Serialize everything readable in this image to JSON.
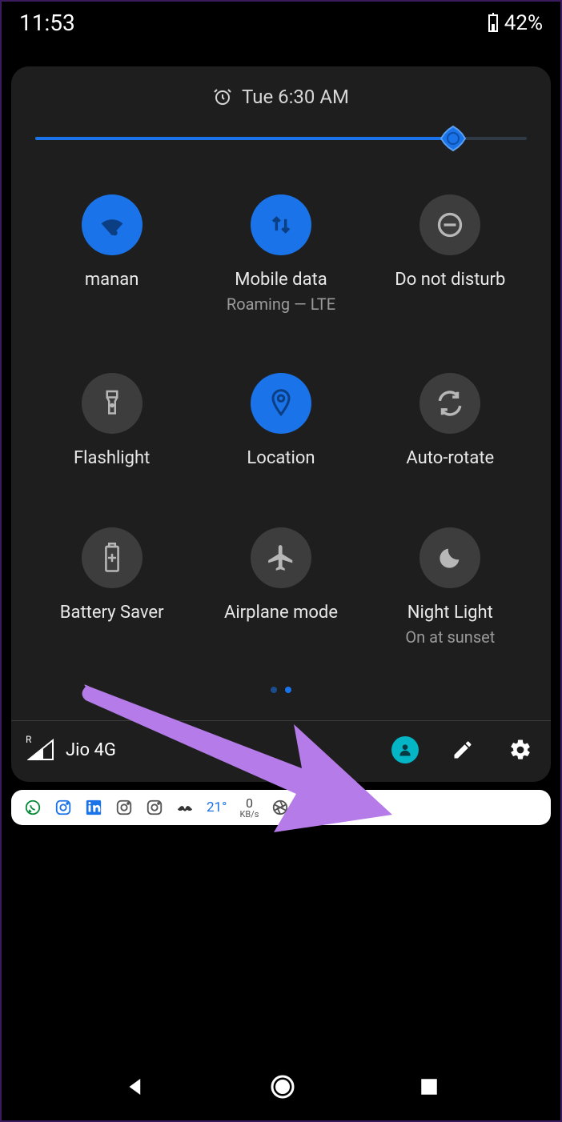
{
  "status": {
    "time": "11:53",
    "battery_pct": "42%"
  },
  "panel": {
    "alarm": "Tue 6:30 AM",
    "brightness_pct": 85,
    "tiles": [
      {
        "label": "manan",
        "sub": "",
        "active": true,
        "icon": "wifi"
      },
      {
        "label": "Mobile data",
        "sub": "Roaming — LTE",
        "active": true,
        "icon": "data"
      },
      {
        "label": "Do not disturb",
        "sub": "",
        "active": false,
        "icon": "dnd"
      },
      {
        "label": "Flashlight",
        "sub": "",
        "active": false,
        "icon": "torch"
      },
      {
        "label": "Location",
        "sub": "",
        "active": true,
        "icon": "location"
      },
      {
        "label": "Auto-rotate",
        "sub": "",
        "active": false,
        "icon": "rotate"
      },
      {
        "label": "Battery Saver",
        "sub": "",
        "active": false,
        "icon": "battery"
      },
      {
        "label": "Airplane mode",
        "sub": "",
        "active": false,
        "icon": "airplane"
      },
      {
        "label": "Night Light",
        "sub": "On at sunset",
        "active": false,
        "icon": "moon"
      }
    ],
    "footer": {
      "carrier": "Jio 4G",
      "roaming_badge": "R"
    }
  },
  "notif_strip": {
    "temp": "21°",
    "net_value": "0",
    "net_unit": "KB/s"
  },
  "colors": {
    "accent": "#1a73e8",
    "user": "#03b5c5",
    "arrow": "#b57be8"
  }
}
